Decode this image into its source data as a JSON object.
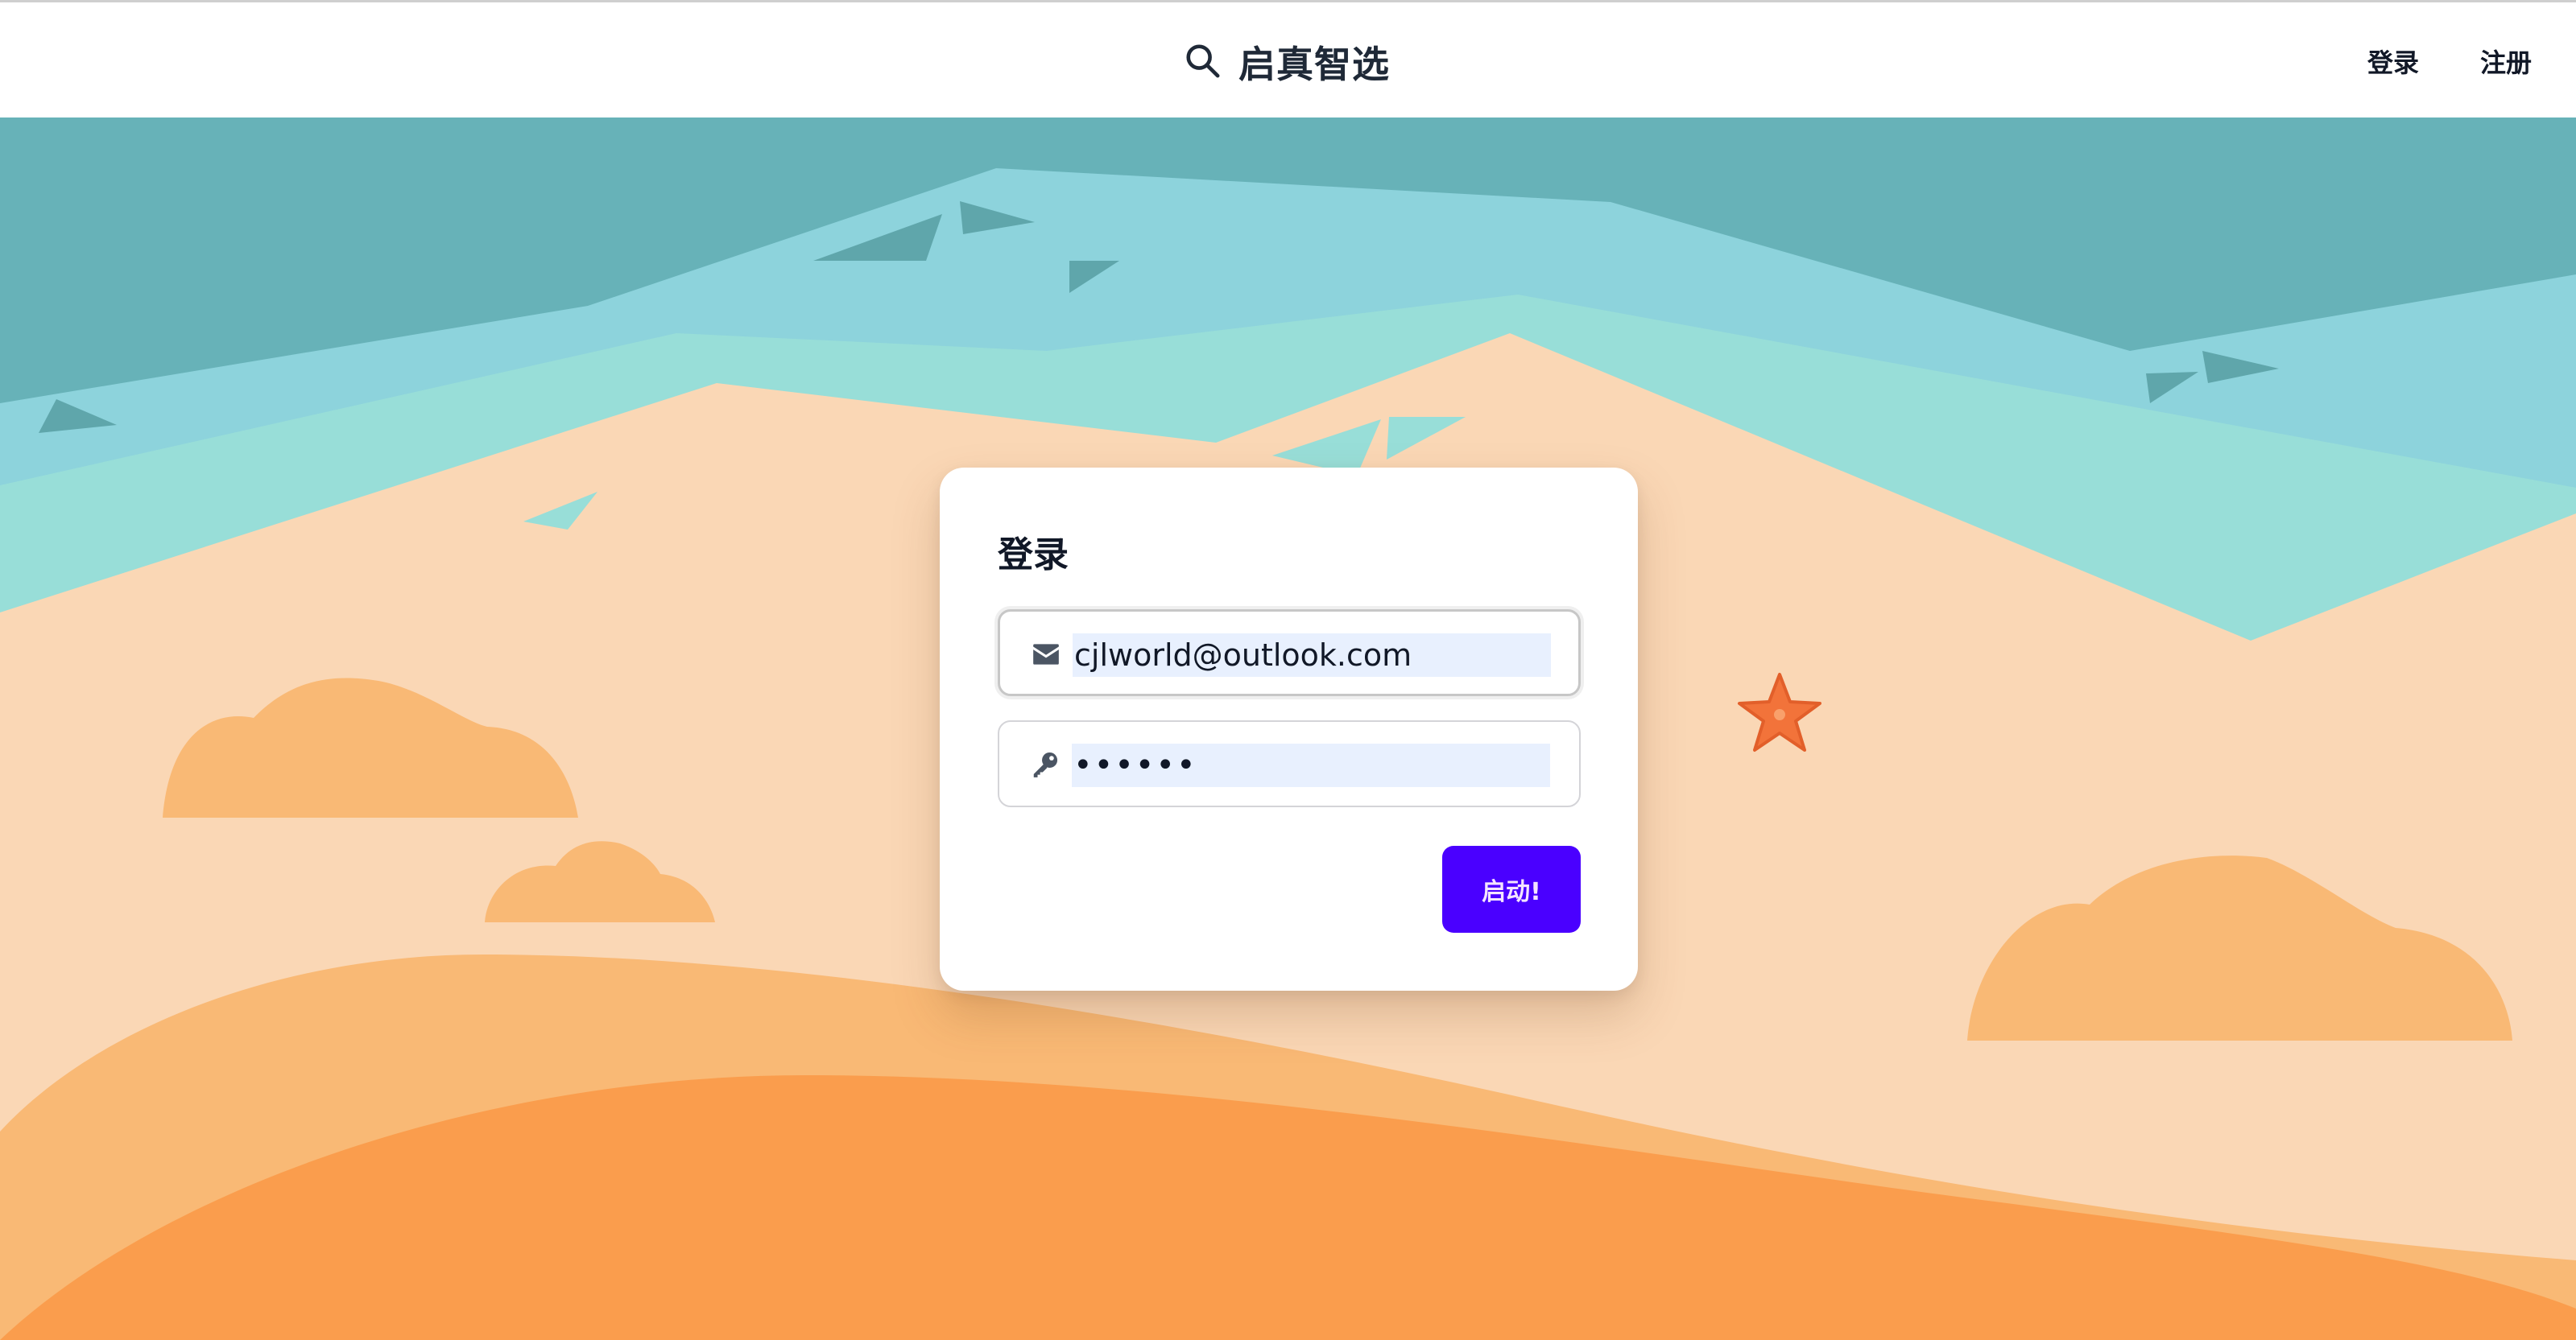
{
  "header": {
    "brand_icon": "search-icon",
    "brand_title": "启真智选",
    "login_link": "登录",
    "register_link": "注册"
  },
  "login_card": {
    "title": "登录",
    "email": {
      "icon": "envelope-icon",
      "value": "cjlworld@outlook.com"
    },
    "password": {
      "icon": "key-icon",
      "value": "••••••"
    },
    "submit_label": "启动!",
    "accent_color": "#4a00ff"
  },
  "background": {
    "sky_color": "#67b2b8",
    "sea_color": "#8dd3dc",
    "shallow_color": "#98ded8",
    "sand_color": "#fad7b5",
    "cloud_color": "#f9b975",
    "dune_color": "#fa9d4d",
    "starfish_icon": "starfish-icon"
  }
}
